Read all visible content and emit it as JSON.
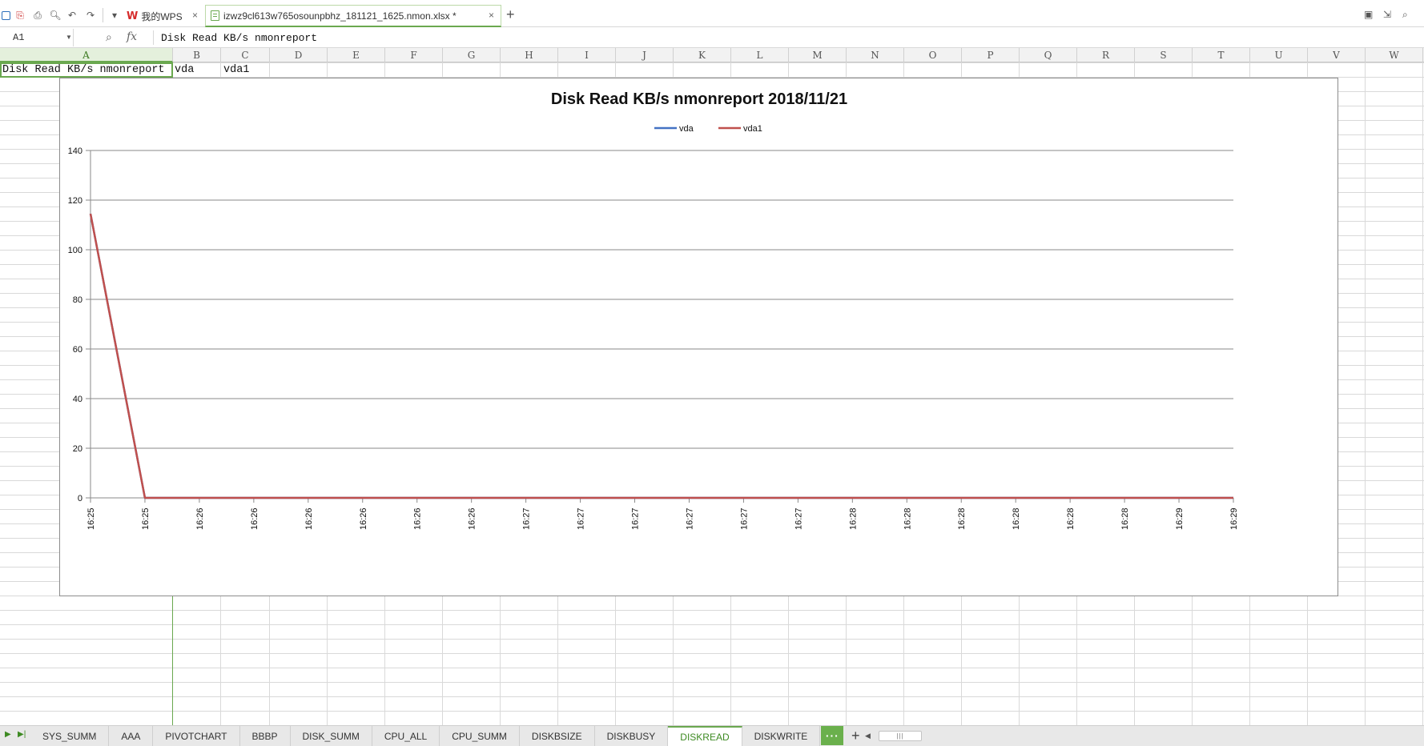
{
  "tabbar": {
    "home_tab_label": "我的WPS",
    "document_tab_label": "izwz9cl613w765osounpbhz_181121_1625.nmon.xlsx *",
    "close_glyph": "×",
    "new_tab_glyph": "+"
  },
  "formula_bar": {
    "cell_reference": "A1",
    "fx_label": "fx",
    "formula_text": "Disk Read KB/s nmonreport"
  },
  "columns": [
    "A",
    "B",
    "C",
    "D",
    "E",
    "F",
    "G",
    "H",
    "I",
    "J",
    "K",
    "L",
    "M",
    "N",
    "O",
    "P",
    "Q",
    "R",
    "S",
    "T",
    "U",
    "V",
    "W"
  ],
  "selected_column": "A",
  "cells": {
    "A1": "Disk Read KB/s nmonreport",
    "B1": "vda",
    "C1": "vda1"
  },
  "chart_data": {
    "type": "line",
    "title": "Disk Read KB/s nmonreport  2018/11/21",
    "xlabel": "",
    "ylabel": "",
    "ylim": [
      0,
      140
    ],
    "yticks": [
      0,
      20,
      40,
      60,
      80,
      100,
      120,
      140
    ],
    "grid": true,
    "legend_position": "top-center",
    "categories": [
      "16:25",
      "16:25",
      "16:26",
      "16:26",
      "16:26",
      "16:26",
      "16:26",
      "16:26",
      "16:27",
      "16:27",
      "16:27",
      "16:27",
      "16:27",
      "16:27",
      "16:28",
      "16:28",
      "16:28",
      "16:28",
      "16:28",
      "16:28",
      "16:29",
      "16:29"
    ],
    "series": [
      {
        "name": "vda",
        "color": "#4472c4",
        "values": [
          114.5,
          0,
          0,
          0,
          0,
          0,
          0,
          0,
          0,
          0,
          0,
          0,
          0,
          0,
          0,
          0,
          0,
          0,
          0,
          0,
          0,
          0
        ]
      },
      {
        "name": "vda1",
        "color": "#c0504d",
        "values": [
          114.5,
          0,
          0,
          0,
          0,
          0,
          0,
          0,
          0,
          0,
          0,
          0,
          0,
          0,
          0,
          0,
          0,
          0,
          0,
          0,
          0,
          0
        ]
      }
    ]
  },
  "sheet_tabs": [
    "SYS_SUMM",
    "AAA",
    "PIVOTCHART",
    "BBBP",
    "DISK_SUMM",
    "CPU_ALL",
    "CPU_SUMM",
    "DISKBSIZE",
    "DISKBUSY",
    "DISKREAD",
    "DISKWRITE"
  ],
  "active_sheet": "DISKREAD",
  "sheetbar": {
    "more_label": "···",
    "add_label": "+"
  },
  "colors": {
    "accent": "#6aa84f",
    "gridline": "#d9d9d9"
  }
}
